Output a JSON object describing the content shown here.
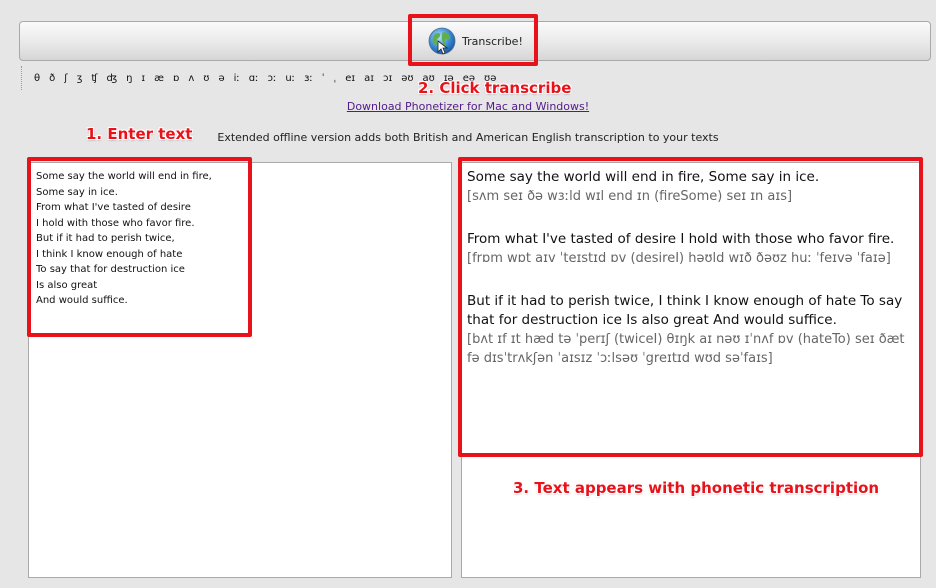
{
  "toolbar": {
    "transcribe_label": "Transcribe!",
    "icon": "globe-icon"
  },
  "ipa_symbols": [
    "θ",
    "ð",
    "ʃ",
    "ʒ",
    "ʧ",
    "ʤ",
    "ŋ",
    "ɪ",
    "æ",
    "ɒ",
    "ʌ",
    "ʊ",
    "ə",
    "iː",
    "ɑː",
    "ɔː",
    "uː",
    "ɜː",
    "ˈ",
    "ˌ",
    "eɪ",
    "aɪ",
    "ɔɪ",
    "əʊ",
    "aʊ",
    "ɪə",
    "eə",
    "ʊə"
  ],
  "download_link": "Download Phonetizer for Mac and Windows!",
  "info_text": "Extended offline version adds both British and American English transcription to your texts",
  "input_lines": [
    "Some say the world will end in fire,",
    "Some say in ice.",
    "From what I've tasted of desire",
    "I hold with those who favor fire.",
    "But if it had to perish twice,",
    "I think I know enough of hate",
    "To say that for destruction ice",
    "Is also great",
    "And would suffice."
  ],
  "output": [
    {
      "text": "Some say the world will end in fire, Some say in ice.",
      "ipa": "[sʌm seɪ ðə wɜːld wɪl end ɪn (fireSome) seɪ ɪn aɪs]"
    },
    {
      "text": "From what I've tasted of desire I hold with those who favor fire.",
      "ipa": "[frɒm wɒt aɪv ˈteɪstɪd ɒv (desireI) həʊld wɪð ðəʊz huː ˈfeɪvə ˈfaɪə]"
    },
    {
      "text": "But if it had to perish twice, I think I know enough of hate To say that for destruction ice Is also great And would suffice.",
      "ipa": "[bʌt ɪf ɪt hæd tə ˈperɪʃ (twiceI) θɪŋk aɪ nəʊ ɪˈnʌf ɒv (hateTo) seɪ ðæt fə dɪsˈtrʌkʃən ˈaɪsɪz ˈɔːlsəʊ ˈgreɪtɪd wʊd səˈfaɪs]"
    }
  ],
  "annotations": {
    "enter_text": "1. Enter text",
    "click_transcribe": "2. Click transcribe",
    "text_appears": "3. Text appears with phonetic transcription"
  },
  "colors": {
    "annotation_red": "#e8121a",
    "link_purple": "#551a8b",
    "ipa_gray": "#666666"
  }
}
